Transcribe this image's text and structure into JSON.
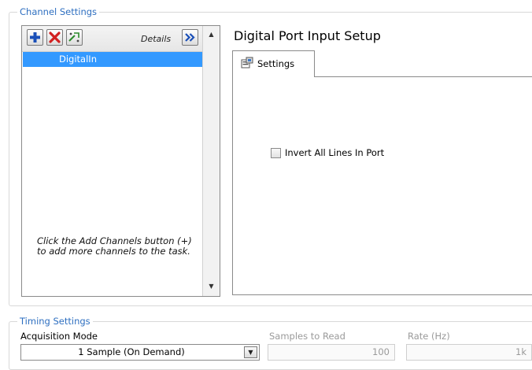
{
  "channel_settings": {
    "group_label": "Channel Settings",
    "toolbar": {
      "add_icon": "plus-icon",
      "remove_icon": "x-icon",
      "configure_icon": "channel-edit-icon",
      "details_label": "Details",
      "details_icon": "double-chevron-right-icon"
    },
    "channels": [
      {
        "name": "DigitalIn",
        "selected": true
      }
    ],
    "hint": "Click the Add Channels button (+) to add more channels to the task.",
    "selection_color": "#3399ff"
  },
  "setup": {
    "title": "Digital Port Input Setup",
    "tabs": [
      {
        "label": "Settings",
        "icon": "settings-tab-icon",
        "active": true
      }
    ],
    "invert_checkbox": {
      "label": "Invert All Lines In Port",
      "checked": false
    }
  },
  "timing_settings": {
    "group_label": "Timing Settings",
    "acquisition_mode": {
      "label": "Acquisition Mode",
      "value": "1 Sample (On Demand)"
    },
    "samples_to_read": {
      "label": "Samples to Read",
      "value": "100",
      "enabled": false
    },
    "rate": {
      "label": "Rate (Hz)",
      "value": "1k",
      "enabled": false
    }
  },
  "colors": {
    "group_label": "#2e6fc0",
    "add_icon": "#1a4fb8",
    "remove_icon": "#d22020"
  }
}
